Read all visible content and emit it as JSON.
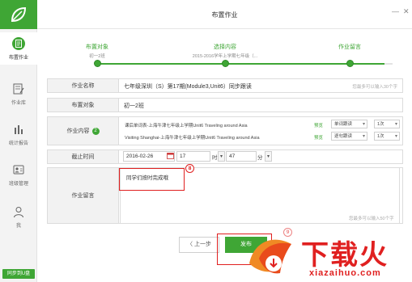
{
  "app": {
    "sidebar_sync": "同步到U盘"
  },
  "sidebar": {
    "items": [
      {
        "label": "布置作业",
        "icon": "assign-homework-icon"
      },
      {
        "label": "作业库",
        "icon": "homework-library-icon"
      },
      {
        "label": "统计报告",
        "icon": "statistics-icon"
      },
      {
        "label": "班级管理",
        "icon": "class-management-icon"
      },
      {
        "label": "我",
        "icon": "person-icon"
      }
    ]
  },
  "header": {
    "title": "布置作业"
  },
  "steps": [
    {
      "label": "布置对象",
      "sub": "初一2班"
    },
    {
      "label": "选择内容",
      "sub": "2015-2016学年上学期七年级（..."
    },
    {
      "label": "作业留言",
      "sub": ""
    }
  ],
  "form": {
    "name_label": "作业名称",
    "name_value": "七年级深圳（S）第17期(Module3,Unit6）同步跟读",
    "name_hint": "您最多可以输入30个字",
    "target_label": "布置对象",
    "target_value": "初一2班",
    "content_label": "作业内容",
    "content_badge": "2",
    "content_items": [
      {
        "text": "课后单词表-上海牛津七年级上学期Unit6 Traveling around Asia",
        "preview": "预览",
        "mode": "单词跟读",
        "count": "1次"
      },
      {
        "text": "Visiting Shanghai-上海牛津七年级上学期Unit6 Traveling around Asia",
        "preview": "预览",
        "mode": "逐句跟读",
        "count": "1次"
      }
    ],
    "deadline_label": "截止时间",
    "deadline_date": "2016-02-26",
    "deadline_hour": "17",
    "hour_unit": "时",
    "deadline_minute": "47",
    "minute_unit": "分",
    "message_label": "作业留言",
    "message_value": "同学们按时完成哦",
    "message_hint": "您最多可以输入50个字"
  },
  "annotations": {
    "step_8": "8",
    "step_9": "9"
  },
  "buttons": {
    "prev": "上一步",
    "publish": "发布"
  },
  "watermark": {
    "text": "下载火",
    "url": "xiazaihuo.com"
  },
  "colors": {
    "accent": "#3fa635",
    "highlight": "#e02020"
  }
}
